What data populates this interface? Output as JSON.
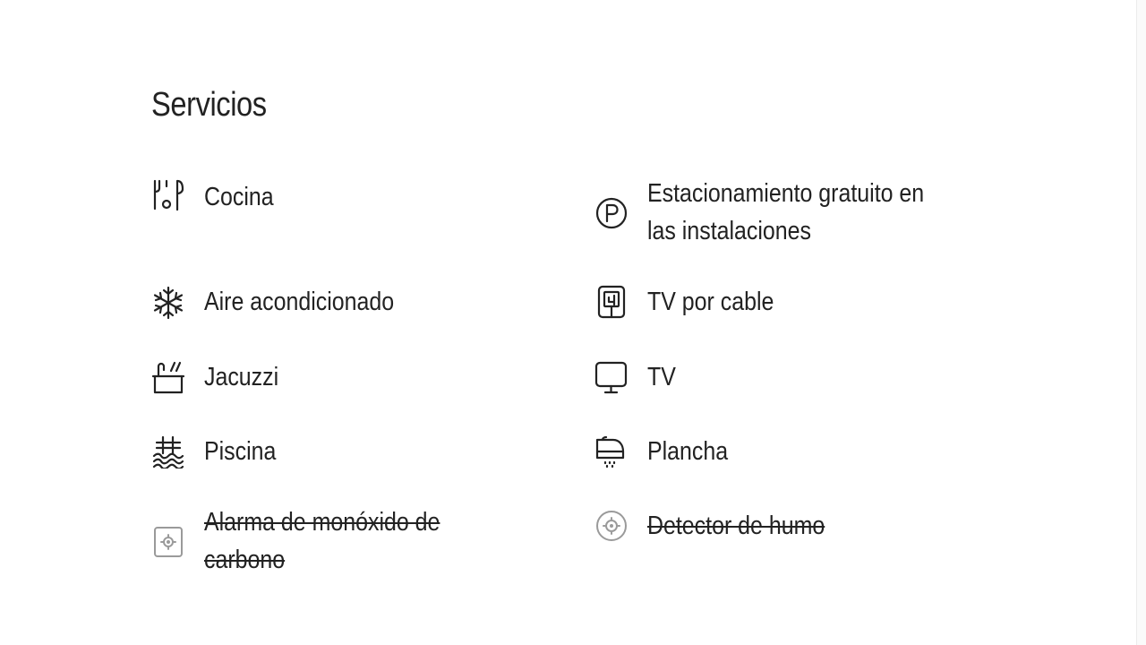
{
  "section": {
    "title": "Servicios"
  },
  "amenities": [
    {
      "label": "Cocina",
      "icon": "utensils-icon",
      "available": true
    },
    {
      "label": "Estacionamiento gratuito en las instalaciones",
      "icon": "parking-icon",
      "available": true
    },
    {
      "label": "Aire acondicionado",
      "icon": "snowflake-icon",
      "available": true
    },
    {
      "label": "TV por cable",
      "icon": "cable-tv-icon",
      "available": true
    },
    {
      "label": "Jacuzzi",
      "icon": "hot-tub-icon",
      "available": true
    },
    {
      "label": "TV",
      "icon": "tv-icon",
      "available": true
    },
    {
      "label": "Piscina",
      "icon": "pool-icon",
      "available": true
    },
    {
      "label": "Plancha",
      "icon": "iron-icon",
      "available": true
    },
    {
      "label": "Alarma de monóxido de carbono",
      "icon": "co-alarm-icon",
      "available": false
    },
    {
      "label": "Detector de humo",
      "icon": "smoke-detector-icon",
      "available": false
    }
  ]
}
